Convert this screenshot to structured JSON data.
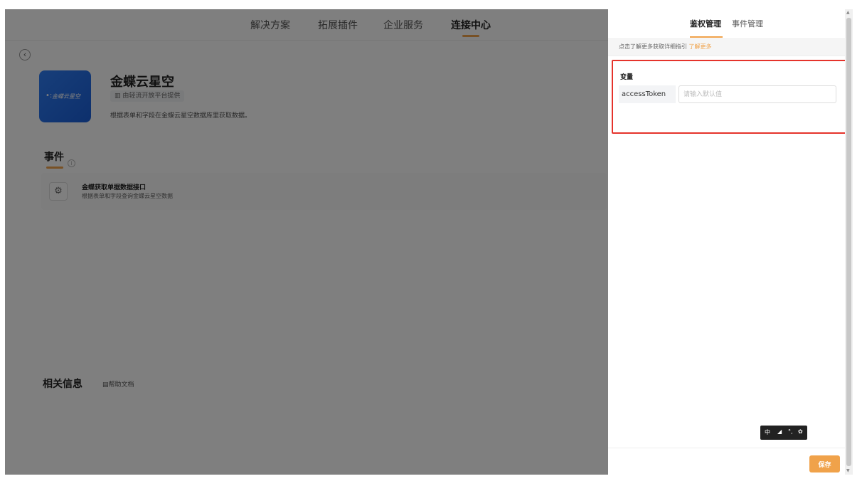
{
  "topnav": {
    "items": [
      "解决方案",
      "拓展插件",
      "企业服务",
      "连接中心"
    ],
    "active_index": 3
  },
  "app": {
    "logo_text": "金蝶云星空",
    "title": "金蝶云星空",
    "provider": "由轻流开放平台提供",
    "description": "根据表单和字段在金蝶云星空数据库里获取数据。"
  },
  "events": {
    "title": "事件",
    "items": [
      {
        "name": "金蝶获取单据数据接口",
        "description": "根据表单和字段查询金蝶云星空数据"
      }
    ]
  },
  "related": {
    "title": "相关信息",
    "help_link": "帮助文档"
  },
  "panel": {
    "tabs": [
      "鉴权管理",
      "事件管理"
    ],
    "active_tab": 0,
    "guide_text": "点击了解更多获取详细指引",
    "guide_link": "了解更多",
    "variables_label": "变量",
    "variables": [
      {
        "key": "accessToken",
        "value": "",
        "placeholder": "请输入默认值"
      }
    ],
    "save_label": "保存"
  },
  "ime_toolbar": {
    "lang": "中"
  },
  "colors": {
    "accent": "#f0a24a",
    "highlight_border": "#e5332b",
    "logo_blue": "#2f7ef5"
  }
}
